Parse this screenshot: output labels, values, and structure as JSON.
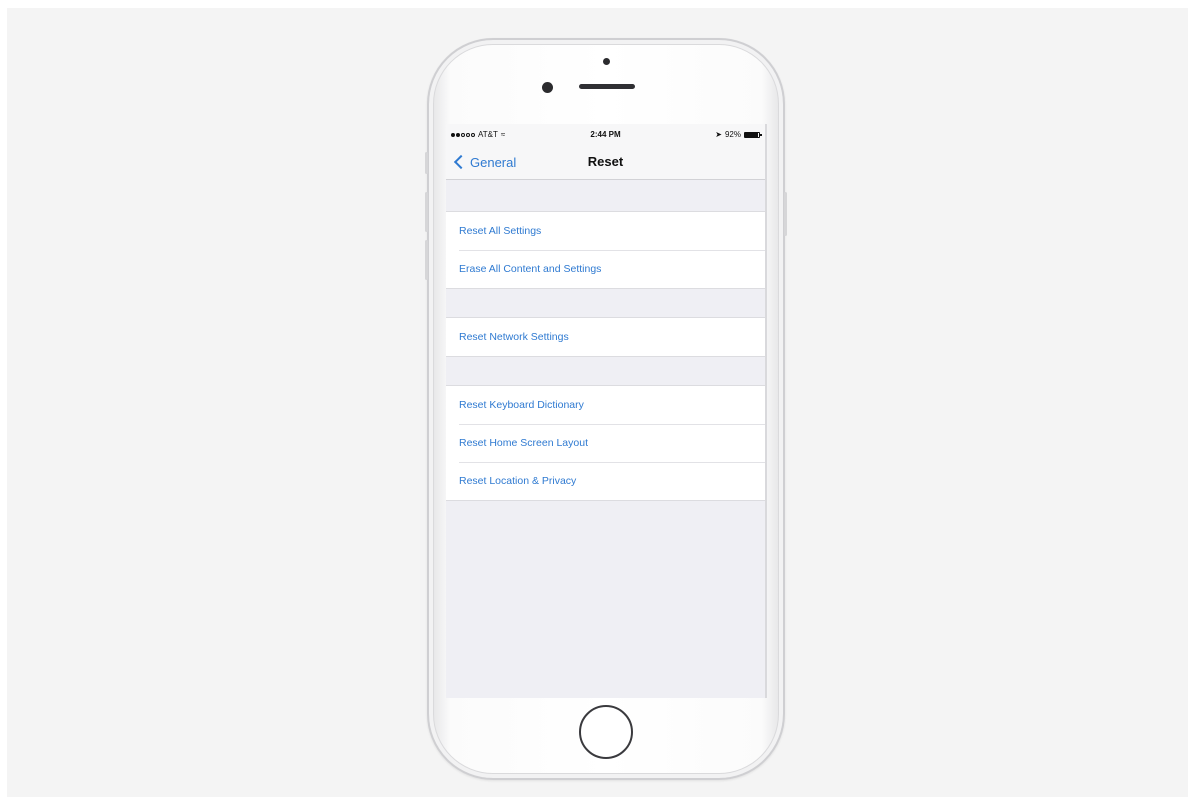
{
  "status_bar": {
    "carrier": "AT&T",
    "time": "2:44 PM",
    "battery_percent": "92%",
    "battery_level": 0.92,
    "icons": [
      "signal-dots-icon",
      "wifi-icon",
      "location-arrow-icon",
      "battery-icon"
    ]
  },
  "nav": {
    "back_label": "General",
    "title": "Reset"
  },
  "groups": [
    {
      "items": [
        "Reset All Settings",
        "Erase All Content and Settings"
      ]
    },
    {
      "items": [
        "Reset Network Settings"
      ]
    },
    {
      "items": [
        "Reset Keyboard Dictionary",
        "Reset Home Screen Layout",
        "Reset Location & Privacy"
      ]
    }
  ],
  "colors": {
    "accent": "#2f7ad1",
    "grouped_background": "#efeff4",
    "cell_background": "#ffffff"
  }
}
